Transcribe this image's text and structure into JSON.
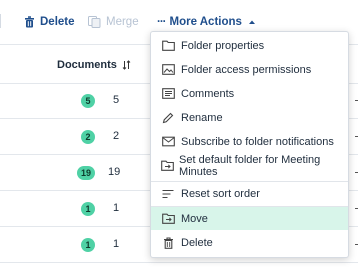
{
  "toolbar": {
    "delete_label": "Delete",
    "merge_label": "Merge",
    "more_actions_label": "More Actions",
    "more_actions_prefix": "···",
    "accent_color": "#1f4e8c"
  },
  "table": {
    "documents_header": "Documents",
    "rows": [
      {
        "badge": "5",
        "count": "5"
      },
      {
        "badge": "2",
        "count": "2"
      },
      {
        "badge": "19",
        "count": "19"
      },
      {
        "badge": "1",
        "count": "1"
      },
      {
        "badge": "1",
        "count": "1"
      }
    ],
    "badge_color": "#4fd1a5"
  },
  "menu": {
    "items": [
      {
        "label": "Folder properties",
        "icon": "folder-icon"
      },
      {
        "label": "Folder access permissions",
        "icon": "image-icon"
      },
      {
        "label": "Comments",
        "icon": "comment-icon"
      },
      {
        "label": "Rename",
        "icon": "pencil-icon"
      },
      {
        "label": "Subscribe to folder notifications",
        "icon": "envelope-icon"
      },
      {
        "label": "Set default folder for Meeting Minutes",
        "icon": "folder-arrow-icon"
      },
      {
        "label": "Reset sort order",
        "icon": "sort-lines-icon"
      },
      {
        "label": "Move",
        "icon": "folder-move-icon",
        "active": true
      },
      {
        "label": "Delete",
        "icon": "trash-icon"
      }
    ],
    "active_color": "#d8f5ea"
  }
}
